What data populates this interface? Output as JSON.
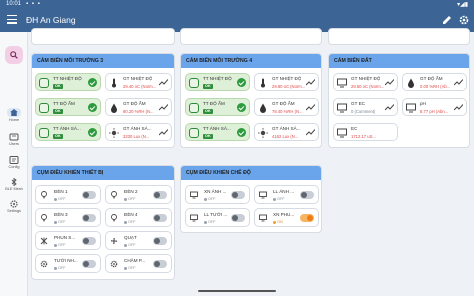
{
  "status": {
    "time": "10:01",
    "right": "▾◢▮"
  },
  "appbar": {
    "title": "ĐH An Giang"
  },
  "rail": {
    "items": [
      {
        "label": "Home"
      },
      {
        "label": "Users"
      },
      {
        "label": "Config"
      },
      {
        "label": "BLE Mesh"
      },
      {
        "label": "Settings"
      }
    ]
  },
  "cards": {
    "env3": {
      "title": "CẢM BIẾN MÔI TRƯỜNG 3",
      "tiles": [
        {
          "label": "TT NHIỆT ĐỘ",
          "value": "OK"
        },
        {
          "label": "GT NHIỆT ĐỘ",
          "value": "29.40 oC (Norm..."
        },
        {
          "label": "TT ĐỘ ẨM",
          "value": "OK"
        },
        {
          "label": "GT ĐỘ ẨM",
          "value": "80.20 %RH (N..."
        },
        {
          "label": "TT ÁNH SÁ...",
          "value": "OK"
        },
        {
          "label": "GT ÁNH SÁ...",
          "value": "3230 Lux (N..."
        }
      ]
    },
    "env4": {
      "title": "CẢM BIẾN MÔI TRƯỜNG 4",
      "tiles": [
        {
          "label": "TT NHIỆT ĐỘ",
          "value": "OK"
        },
        {
          "label": "GT NHIỆT ĐỘ",
          "value": "29.80 oC (Norm..."
        },
        {
          "label": "TT ĐỘ ẨM",
          "value": "OK"
        },
        {
          "label": "GT ĐỘ ẨM",
          "value": "78.40 %RH (N..."
        },
        {
          "label": "TT ÁNH SÁ...",
          "value": "OK"
        },
        {
          "label": "GT ÁNH SÁ...",
          "value": "4162 Lux (N..."
        }
      ]
    },
    "soil": {
      "title": "CẢM BIẾN ĐẤT",
      "tiles": [
        {
          "label": "GT NHIỆT ĐỘ",
          "value": "29.50 oC (Norm..."
        },
        {
          "label": "GT ĐỘ ẨM",
          "value": "0.00 %RH (Ab..."
        },
        {
          "label": "GT EC",
          "value": "0 (Comment)"
        },
        {
          "label": "pH",
          "value": "8.77 pH (Abn..."
        },
        {
          "label": "EC",
          "value": "1712.17 uS..."
        }
      ]
    },
    "devices": {
      "title": "CỤM ĐIỀU KHIỂN THIẾT BỊ",
      "tiles": [
        {
          "label": "ĐÈN 1",
          "status": "OFF"
        },
        {
          "label": "ĐÈN 2",
          "status": "OFF"
        },
        {
          "label": "ĐÈN 3",
          "status": "OFF"
        },
        {
          "label": "ĐÈN 4",
          "status": "OFF"
        },
        {
          "label": "PHUN S...",
          "status": "OFF"
        },
        {
          "label": "QUẠT",
          "status": "OFF"
        },
        {
          "label": "TƯỚI NH...",
          "status": "OFF"
        },
        {
          "label": "CHĂM P...",
          "status": "OFF"
        }
      ]
    },
    "modes": {
      "title": "CỤM ĐIỀU KHIỂN CHẾ ĐỘ",
      "tiles": [
        {
          "label": "XN ÁNH ...",
          "status": "OFF"
        },
        {
          "label": "LL ÁNH ...",
          "status": "OFF"
        },
        {
          "label": "LL TƯỚI ...",
          "status": "OFF"
        },
        {
          "label": "XN PHU...",
          "status": "ON"
        }
      ]
    }
  },
  "colors": {
    "appbar": "#3c6595",
    "card_header": "#6aa4ea",
    "ok_green": "#2f8f3b",
    "value_red": "#e14848",
    "toggle_on": "#f07d12"
  }
}
